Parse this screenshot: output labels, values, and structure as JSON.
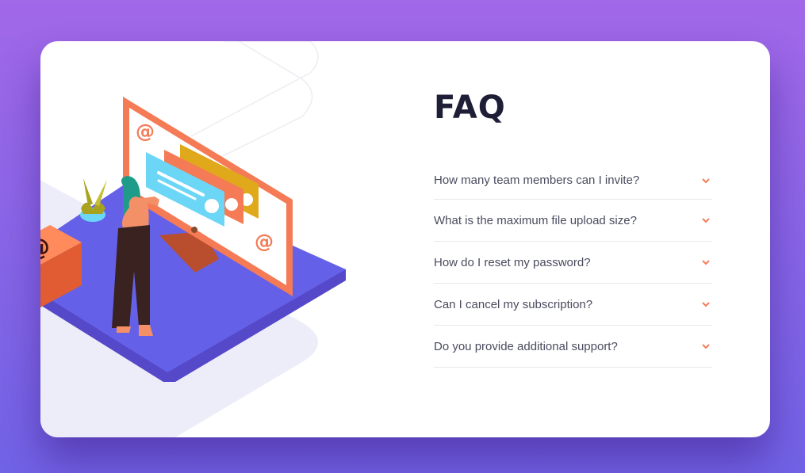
{
  "page": {
    "background_gradient": [
      "#a168e8",
      "#7163e6"
    ]
  },
  "faq": {
    "title": "FAQ",
    "items": [
      {
        "question": "How many team members can I invite?"
      },
      {
        "question": "What is the maximum file upload size?"
      },
      {
        "question": "How do I reset my password?"
      },
      {
        "question": "Can I cancel my subscription?"
      },
      {
        "question": "Do you provide additional support?"
      }
    ],
    "accent_color": "#f47b56"
  },
  "illustration": {
    "icon_glyph": "@"
  }
}
